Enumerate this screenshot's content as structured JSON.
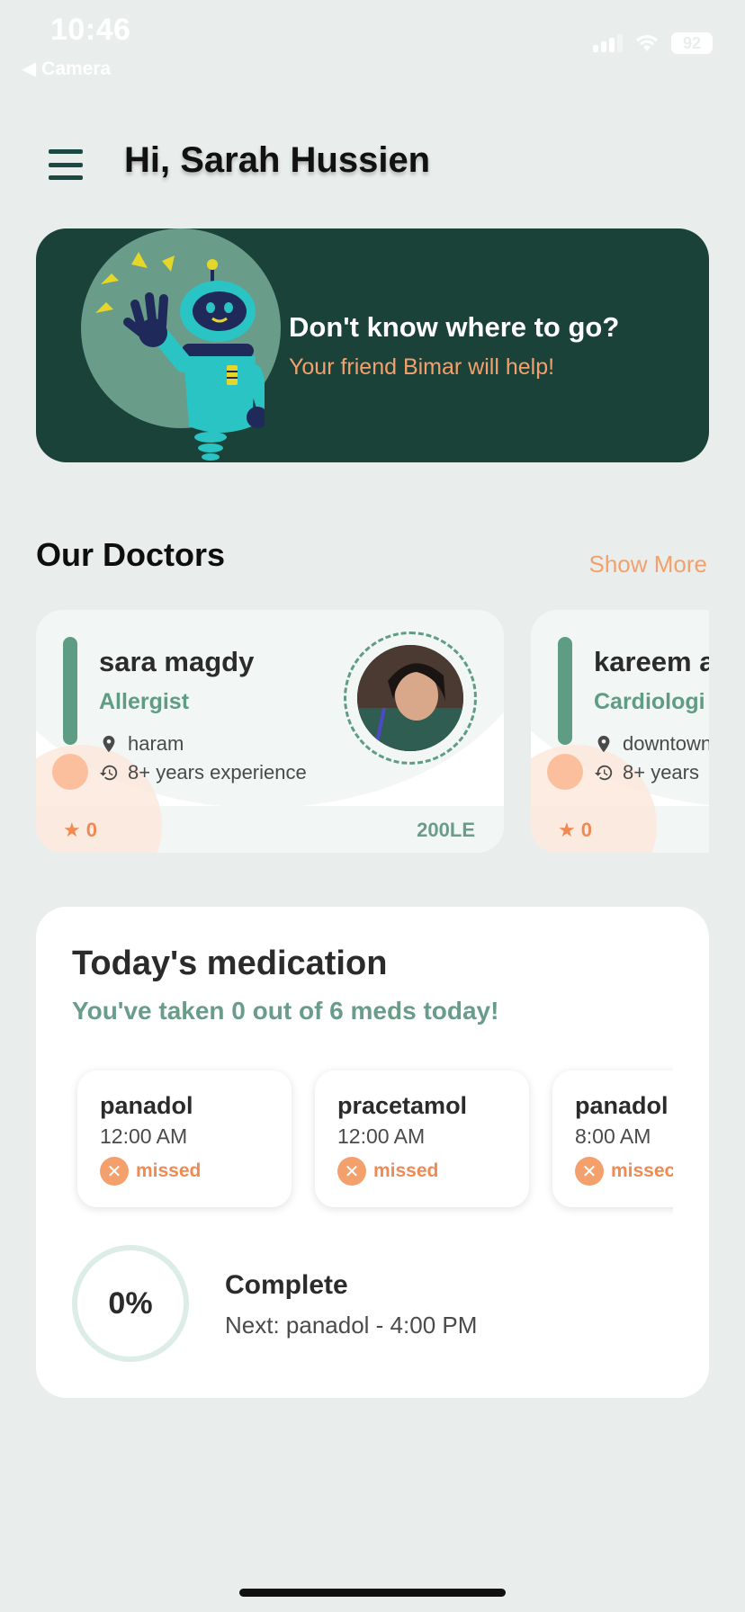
{
  "status_bar": {
    "time": "10:46",
    "back_label": "Camera",
    "battery": "92"
  },
  "header": {
    "greeting": "Hi, Sarah Hussien"
  },
  "banner": {
    "title": "Don't know where to go?",
    "subtitle": "Your friend Bimar will help!"
  },
  "doctors": {
    "title": "Our Doctors",
    "show_more": "Show More",
    "items": [
      {
        "name": "sara magdy",
        "specialty": "Allergist",
        "location": "haram",
        "experience": "8+ years experience",
        "rating": "0",
        "price": "200LE"
      },
      {
        "name": "kareem a",
        "specialty": "Cardiologi",
        "location": "downtown",
        "experience": "8+ years",
        "rating": "0"
      }
    ]
  },
  "medication": {
    "title": "Today's medication",
    "subtitle": "You've taken 0 out of 6 meds today!",
    "meds": [
      {
        "name": "panadol",
        "time": "12:00 AM",
        "status": "missed"
      },
      {
        "name": "pracetamol",
        "time": "12:00 AM",
        "status": "missed"
      },
      {
        "name": "panadol",
        "time": "8:00 AM",
        "status": "missec"
      }
    ],
    "progress": "0%",
    "progress_label": "Complete",
    "next": "Next: panadol - 4:00 PM"
  },
  "colors": {
    "primary_dark": "#1a4239",
    "accent": "#f4a06c",
    "green": "#5f9c84",
    "background": "#e9eeec"
  },
  "icons": [
    "menu-icon",
    "robot-illustration",
    "location-pin-icon",
    "history-icon",
    "star-icon",
    "x-circle-icon"
  ]
}
